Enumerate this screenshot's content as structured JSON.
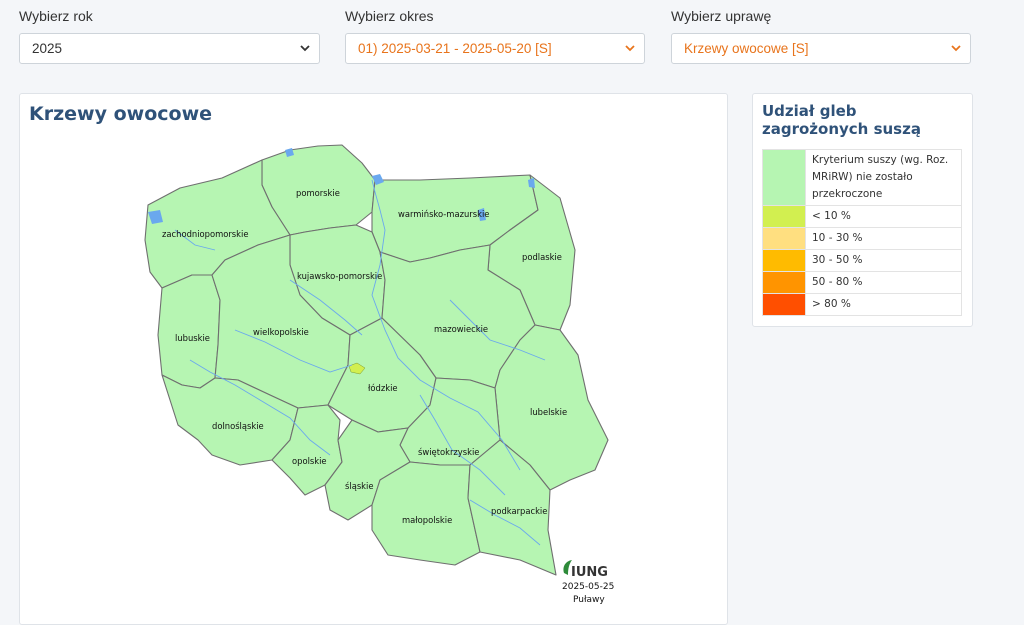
{
  "filters": {
    "year": {
      "label": "Wybierz rok",
      "value": "2025"
    },
    "period": {
      "label": "Wybierz okres",
      "value": "01) 2025-03-21 - 2025-05-20 [S]"
    },
    "crop": {
      "label": "Wybierz uprawę",
      "value": "Krzewy owocowe [S]"
    }
  },
  "map": {
    "title": "Krzewy owocowe",
    "regions": [
      {
        "name": "pomorskie",
        "color": "#b6f5b2"
      },
      {
        "name": "warmińsko-mazurskie",
        "color": "#b6f5b2"
      },
      {
        "name": "zachodniopomorskie",
        "color": "#b6f5b2"
      },
      {
        "name": "podlaskie",
        "color": "#b6f5b2"
      },
      {
        "name": "kujawsko-pomorskie",
        "color": "#b6f5b2"
      },
      {
        "name": "lubuskie",
        "color": "#b6f5b2"
      },
      {
        "name": "wielkopolskie",
        "color": "#b6f5b2"
      },
      {
        "name": "mazowieckie",
        "color": "#b6f5b2"
      },
      {
        "name": "łódzkie",
        "color": "#b6f5b2"
      },
      {
        "name": "lubelskie",
        "color": "#b6f5b2"
      },
      {
        "name": "dolnośląskie",
        "color": "#b6f5b2"
      },
      {
        "name": "opolskie",
        "color": "#b6f5b2"
      },
      {
        "name": "świętokrzyskie",
        "color": "#b6f5b2"
      },
      {
        "name": "śląskie",
        "color": "#b6f5b2"
      },
      {
        "name": "małopolskie",
        "color": "#b6f5b2"
      },
      {
        "name": "podkarpackie",
        "color": "#b6f5b2"
      }
    ],
    "logo": "IUNG",
    "date": "2025-05-25",
    "place": "Puławy"
  },
  "legend": {
    "title": "Udział gleb zagrożonych suszą",
    "items": [
      {
        "label": "Kryterium suszy (wg. Roz. MRiRW) nie zostało przekroczone",
        "color": "#b6f5b2"
      },
      {
        "label": "< 10 %",
        "color": "#d2ef50"
      },
      {
        "label": "10 - 30 %",
        "color": "#ffdf80"
      },
      {
        "label": "30 - 50 %",
        "color": "#ffbb00"
      },
      {
        "label": "50 - 80 %",
        "color": "#ff9400"
      },
      {
        "label": "> 80 %",
        "color": "#ff4f00"
      }
    ]
  },
  "colors": {
    "water": "#6aa8ee",
    "border": "#6f6f6f",
    "drought_spot": "#d2ef50"
  }
}
